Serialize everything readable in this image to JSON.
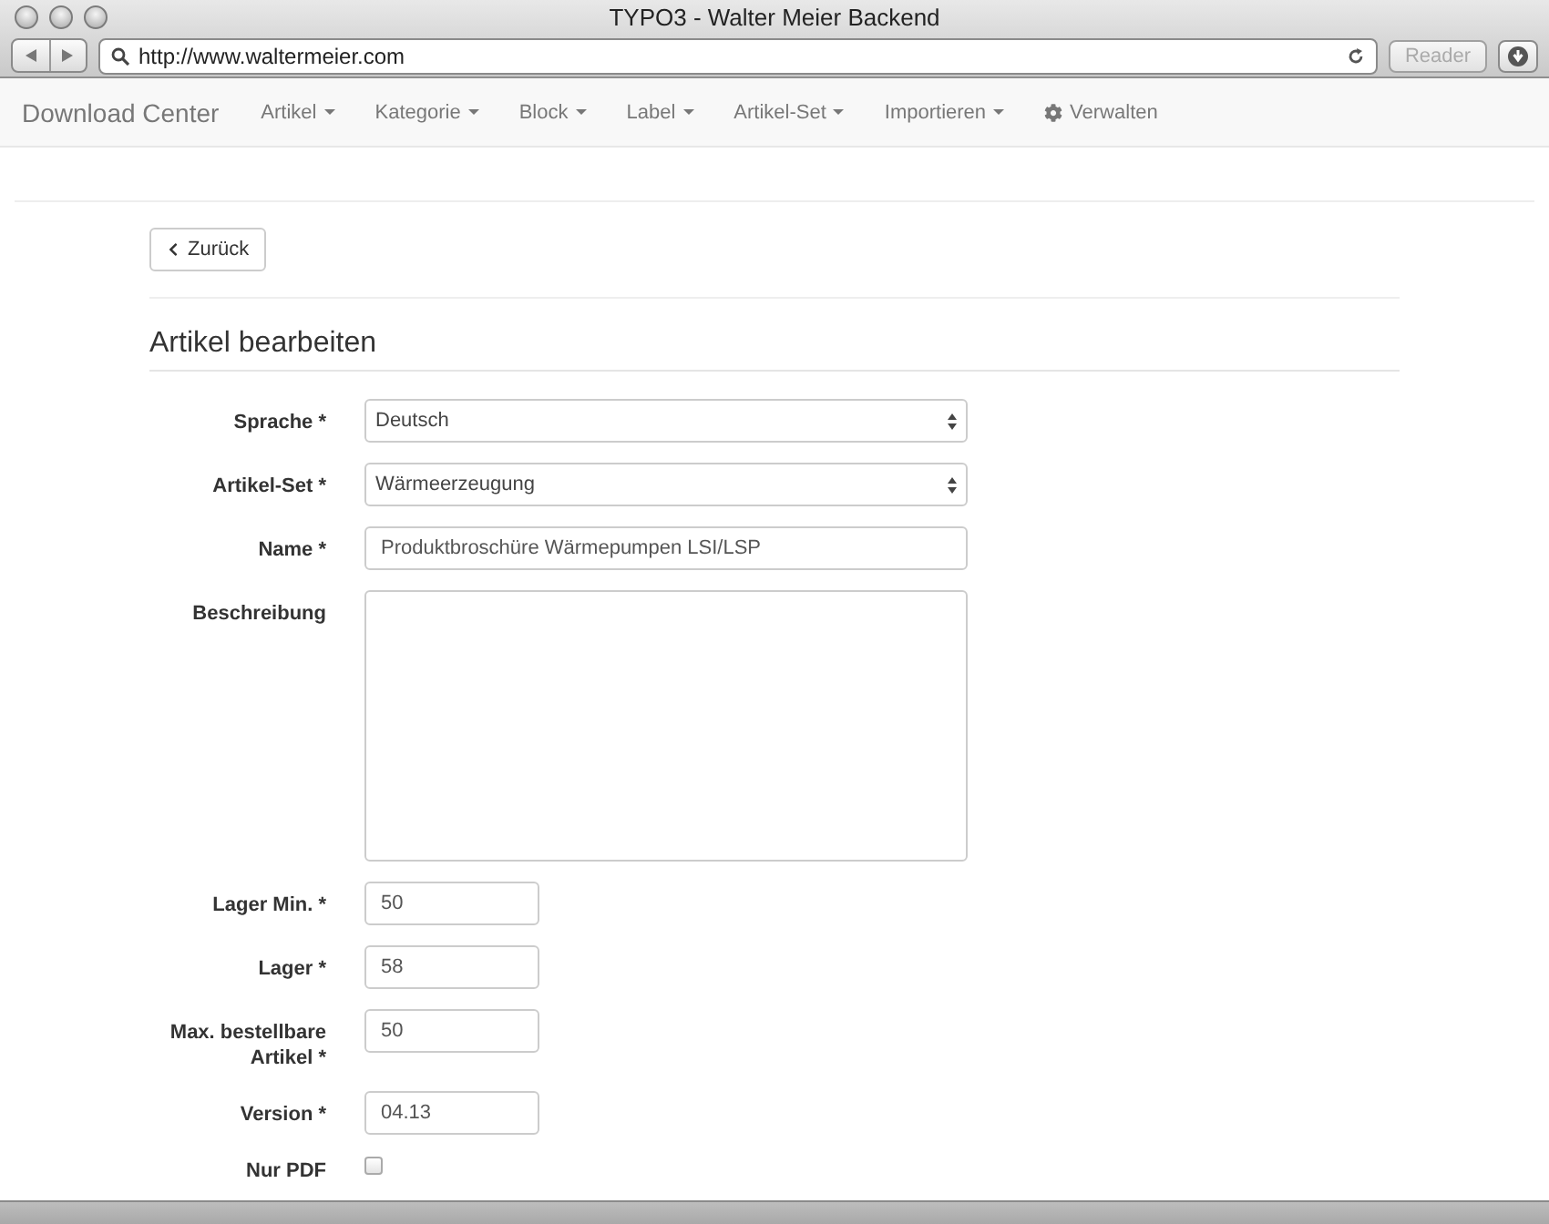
{
  "window": {
    "title": "TYPO3 - Walter Meier Backend"
  },
  "browser": {
    "url": "http://www.waltermeier.com",
    "reader_label": "Reader"
  },
  "navbar": {
    "brand": "Download Center",
    "items": [
      {
        "label": "Artikel",
        "kind": "dropdown"
      },
      {
        "label": "Kategorie",
        "kind": "dropdown"
      },
      {
        "label": "Block",
        "kind": "dropdown"
      },
      {
        "label": "Label",
        "kind": "dropdown"
      },
      {
        "label": "Artikel-Set",
        "kind": "dropdown"
      },
      {
        "label": "Importieren",
        "kind": "dropdown"
      },
      {
        "label": "Verwalten",
        "kind": "settings"
      }
    ]
  },
  "back_button": "Zurück",
  "heading": "Artikel bearbeiten",
  "fields": [
    {
      "label": "Sprache *",
      "kind": "select",
      "value": "Deutsch"
    },
    {
      "label": "Artikel-Set *",
      "kind": "select",
      "value": "Wärmeerzeugung"
    },
    {
      "label": "Name *",
      "kind": "text",
      "value": "Produktbroschüre Wärmepumpen LSI/LSP"
    },
    {
      "label": "Beschreibung",
      "kind": "textarea"
    },
    {
      "label": "Lager Min. *",
      "kind": "short",
      "value": "50"
    },
    {
      "label": "Lager *",
      "kind": "short",
      "value": "58"
    },
    {
      "label": "Max. bestellbare Artikel *",
      "kind": "short",
      "value": "50"
    },
    {
      "label": "Version *",
      "kind": "short",
      "value": "04.13"
    },
    {
      "label": "Nur PDF",
      "kind": "checkbox",
      "checked": false
    }
  ]
}
